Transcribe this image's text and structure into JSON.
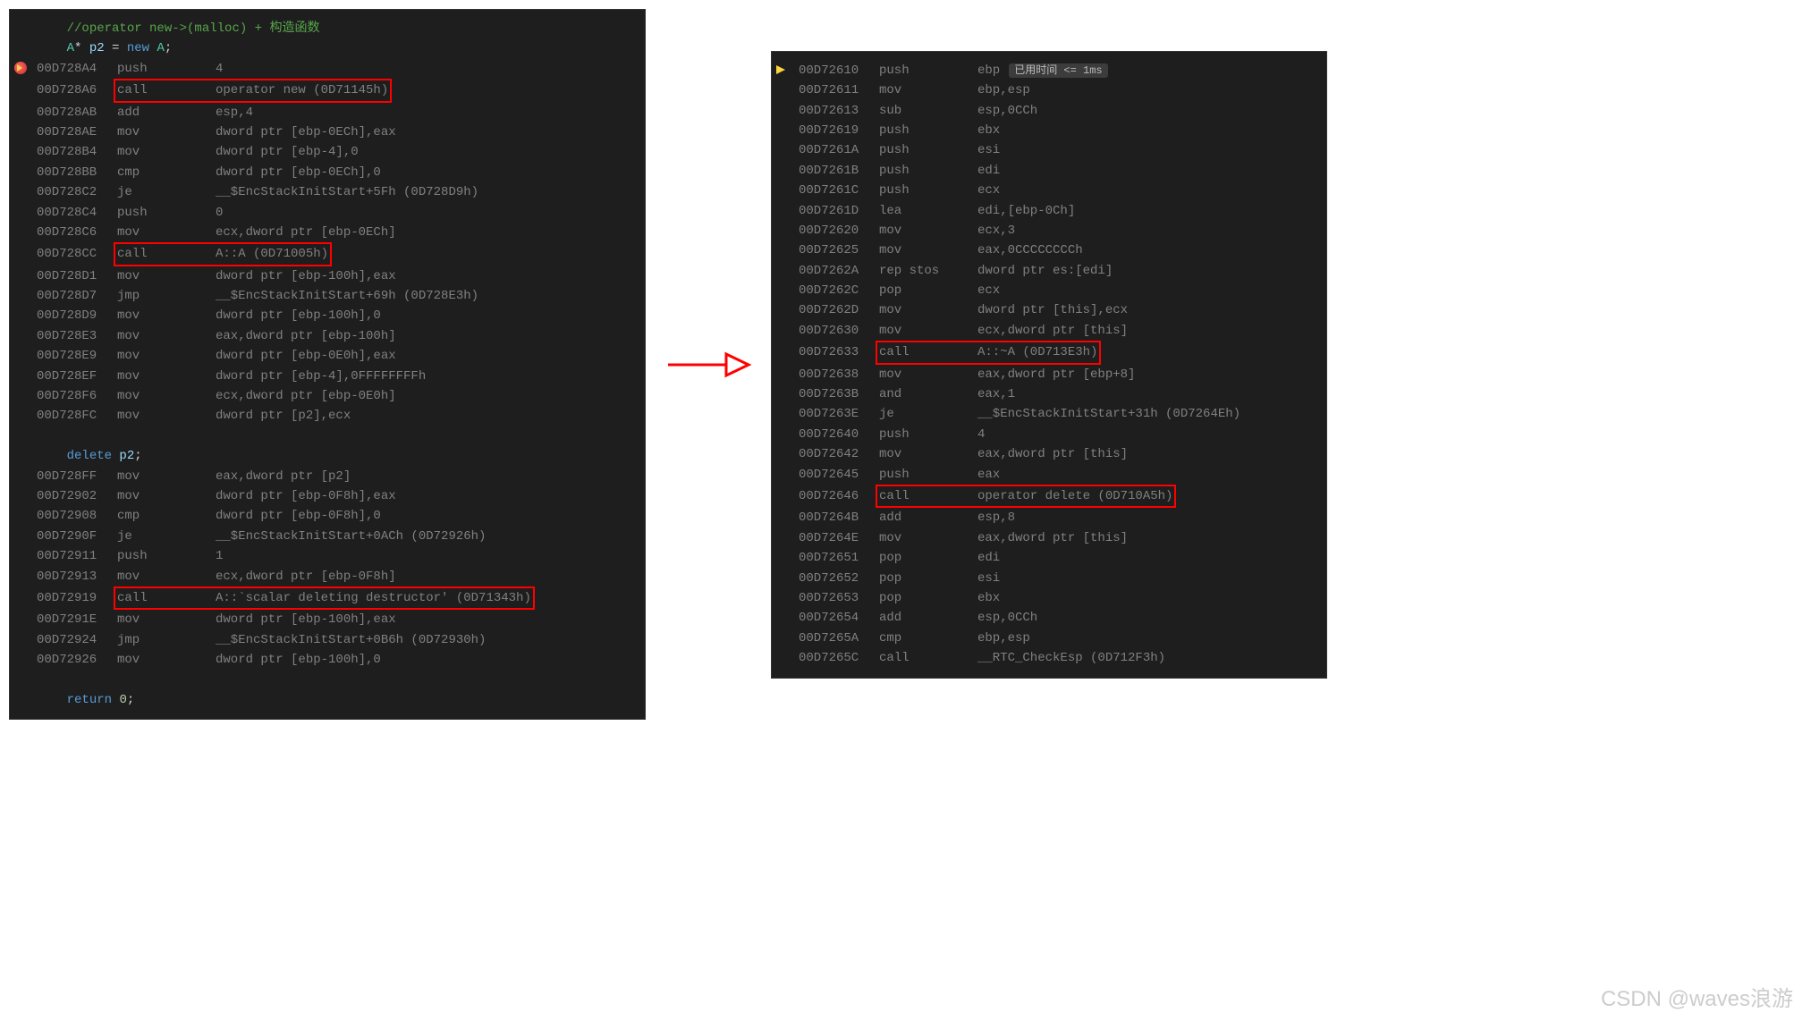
{
  "left": {
    "lines": [
      {
        "type": "src",
        "text": "//operator new->(malloc) + 构造函数",
        "cls": "comment"
      },
      {
        "type": "src_decl",
        "parts": [
          "A",
          "*",
          " p2 ",
          "=",
          " ",
          "new",
          " ",
          "A",
          ";"
        ]
      },
      {
        "addr": "00D728A4",
        "mnem": "push",
        "opnd": "4",
        "icon": "bpcur"
      },
      {
        "addr": "00D728A6",
        "mnem": "call",
        "opnd": "operator new (0D71145h)",
        "box": true,
        "boxfull": true
      },
      {
        "addr": "00D728AB",
        "mnem": "add",
        "opnd": "esp,4"
      },
      {
        "addr": "00D728AE",
        "mnem": "mov",
        "opnd": "dword ptr [ebp-0ECh],eax"
      },
      {
        "addr": "00D728B4",
        "mnem": "mov",
        "opnd": "dword ptr [ebp-4],0"
      },
      {
        "addr": "00D728BB",
        "mnem": "cmp",
        "opnd": "dword ptr [ebp-0ECh],0"
      },
      {
        "addr": "00D728C2",
        "mnem": "je",
        "opnd": "__$EncStackInitStart+5Fh (0D728D9h)"
      },
      {
        "addr": "00D728C4",
        "mnem": "push",
        "opnd": "0"
      },
      {
        "addr": "00D728C6",
        "mnem": "mov",
        "opnd": "ecx,dword ptr [ebp-0ECh]"
      },
      {
        "addr": "00D728CC",
        "mnem": "call",
        "opnd": "A::A (0D71005h)",
        "box": true,
        "boxfull": true
      },
      {
        "addr": "00D728D1",
        "mnem": "mov",
        "opnd": "dword ptr [ebp-100h],eax"
      },
      {
        "addr": "00D728D7",
        "mnem": "jmp",
        "opnd": "__$EncStackInitStart+69h (0D728E3h)"
      },
      {
        "addr": "00D728D9",
        "mnem": "mov",
        "opnd": "dword ptr [ebp-100h],0"
      },
      {
        "addr": "00D728E3",
        "mnem": "mov",
        "opnd": "eax,dword ptr [ebp-100h]"
      },
      {
        "addr": "00D728E9",
        "mnem": "mov",
        "opnd": "dword ptr [ebp-0E0h],eax"
      },
      {
        "addr": "00D728EF",
        "mnem": "mov",
        "opnd": "dword ptr [ebp-4],0FFFFFFFFh"
      },
      {
        "addr": "00D728F6",
        "mnem": "mov",
        "opnd": "ecx,dword ptr [ebp-0E0h]"
      },
      {
        "addr": "00D728FC",
        "mnem": "mov",
        "opnd": "dword ptr [p2],ecx"
      },
      {
        "type": "blank"
      },
      {
        "type": "src_del",
        "parts": [
          "delete",
          " p2",
          ";"
        ]
      },
      {
        "addr": "00D728FF",
        "mnem": "mov",
        "opnd": "eax,dword ptr [p2]"
      },
      {
        "addr": "00D72902",
        "mnem": "mov",
        "opnd": "dword ptr [ebp-0F8h],eax"
      },
      {
        "addr": "00D72908",
        "mnem": "cmp",
        "opnd": "dword ptr [ebp-0F8h],0"
      },
      {
        "addr": "00D7290F",
        "mnem": "je",
        "opnd": "__$EncStackInitStart+0ACh (0D72926h)"
      },
      {
        "addr": "00D72911",
        "mnem": "push",
        "opnd": "1"
      },
      {
        "addr": "00D72913",
        "mnem": "mov",
        "opnd": "ecx,dword ptr [ebp-0F8h]"
      },
      {
        "addr": "00D72919",
        "mnem": "call",
        "opnd": "A::`scalar deleting destructor' (0D71343h)",
        "box": true,
        "boxfull": true
      },
      {
        "addr": "00D7291E",
        "mnem": "mov",
        "opnd": "dword ptr [ebp-100h],eax"
      },
      {
        "addr": "00D72924",
        "mnem": "jmp",
        "opnd": "__$EncStackInitStart+0B6h (0D72930h)"
      },
      {
        "addr": "00D72926",
        "mnem": "mov",
        "opnd": "dword ptr [ebp-100h],0"
      },
      {
        "type": "blank"
      },
      {
        "type": "src_ret",
        "parts": [
          "return",
          " ",
          "0",
          ";"
        ]
      }
    ]
  },
  "right": {
    "badge": "已用时间 <= 1ms",
    "lines": [
      {
        "addr": "00D72610",
        "mnem": "push",
        "opnd": "ebp",
        "icon": "cur",
        "badge": true
      },
      {
        "addr": "00D72611",
        "mnem": "mov",
        "opnd": "ebp,esp"
      },
      {
        "addr": "00D72613",
        "mnem": "sub",
        "opnd": "esp,0CCh"
      },
      {
        "addr": "00D72619",
        "mnem": "push",
        "opnd": "ebx"
      },
      {
        "addr": "00D7261A",
        "mnem": "push",
        "opnd": "esi"
      },
      {
        "addr": "00D7261B",
        "mnem": "push",
        "opnd": "edi"
      },
      {
        "addr": "00D7261C",
        "mnem": "push",
        "opnd": "ecx"
      },
      {
        "addr": "00D7261D",
        "mnem": "lea",
        "opnd": "edi,[ebp-0Ch]"
      },
      {
        "addr": "00D72620",
        "mnem": "mov",
        "opnd": "ecx,3"
      },
      {
        "addr": "00D72625",
        "mnem": "mov",
        "opnd": "eax,0CCCCCCCCh"
      },
      {
        "addr": "00D7262A",
        "mnem": "rep stos",
        "opnd": "dword ptr es:[edi]"
      },
      {
        "addr": "00D7262C",
        "mnem": "pop",
        "opnd": "ecx"
      },
      {
        "addr": "00D7262D",
        "mnem": "mov",
        "opnd": "dword ptr [this],ecx"
      },
      {
        "addr": "00D72630",
        "mnem": "mov",
        "opnd": "ecx,dword ptr [this]"
      },
      {
        "addr": "00D72633",
        "mnem": "call",
        "opnd": "A::~A (0D713E3h)",
        "box": true,
        "boxfull": true
      },
      {
        "addr": "00D72638",
        "mnem": "mov",
        "opnd": "eax,dword ptr [ebp+8]"
      },
      {
        "addr": "00D7263B",
        "mnem": "and",
        "opnd": "eax,1"
      },
      {
        "addr": "00D7263E",
        "mnem": "je",
        "opnd": "__$EncStackInitStart+31h (0D7264Eh)"
      },
      {
        "addr": "00D72640",
        "mnem": "push",
        "opnd": "4"
      },
      {
        "addr": "00D72642",
        "mnem": "mov",
        "opnd": "eax,dword ptr [this]"
      },
      {
        "addr": "00D72645",
        "mnem": "push",
        "opnd": "eax"
      },
      {
        "addr": "00D72646",
        "mnem": "call",
        "opnd": "operator delete (0D710A5h)",
        "box": true,
        "boxfull": true
      },
      {
        "addr": "00D7264B",
        "mnem": "add",
        "opnd": "esp,8"
      },
      {
        "addr": "00D7264E",
        "mnem": "mov",
        "opnd": "eax,dword ptr [this]"
      },
      {
        "addr": "00D72651",
        "mnem": "pop",
        "opnd": "edi"
      },
      {
        "addr": "00D72652",
        "mnem": "pop",
        "opnd": "esi"
      },
      {
        "addr": "00D72653",
        "mnem": "pop",
        "opnd": "ebx"
      },
      {
        "addr": "00D72654",
        "mnem": "add",
        "opnd": "esp,0CCh"
      },
      {
        "addr": "00D7265A",
        "mnem": "cmp",
        "opnd": "ebp,esp"
      },
      {
        "addr": "00D7265C",
        "mnem": "call",
        "opnd": "__RTC_CheckEsp (0D712F3h)"
      }
    ]
  },
  "watermark": "CSDN @waves浪游"
}
